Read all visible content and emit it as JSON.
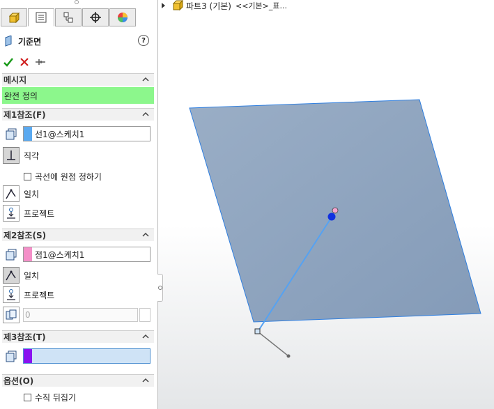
{
  "feature_title": "기준면",
  "message": {
    "header": "메시지",
    "text": "완전 정의"
  },
  "ref1": {
    "header": "제1참조(F)",
    "selection": "선1@스케치1",
    "swatch_color": "#5aa9f0",
    "option_perpendicular": "직각",
    "checkbox_origin_on_curve": "곡선에 원점 정하기",
    "option_coincident": "일치",
    "option_project": "프로젝트"
  },
  "ref2": {
    "header": "제2참조(S)",
    "selection": "점1@스케치1",
    "swatch_color": "#f48fc8",
    "option_coincident": "일치",
    "option_project": "프로젝트",
    "count_value": "0"
  },
  "ref3": {
    "header": "제3참조(T)",
    "swatch_color": "#8a12f0"
  },
  "options": {
    "header": "옵션(O)",
    "checkbox_flip_normal": "수직 뒤집기"
  },
  "tree": {
    "part_name": "파트3 (기본)",
    "config": "<<기본>_표..."
  },
  "colors": {
    "plane_fill": "#8fa3bf",
    "plane_edge": "#2f7fe0",
    "message_bg": "#8cf78c"
  }
}
